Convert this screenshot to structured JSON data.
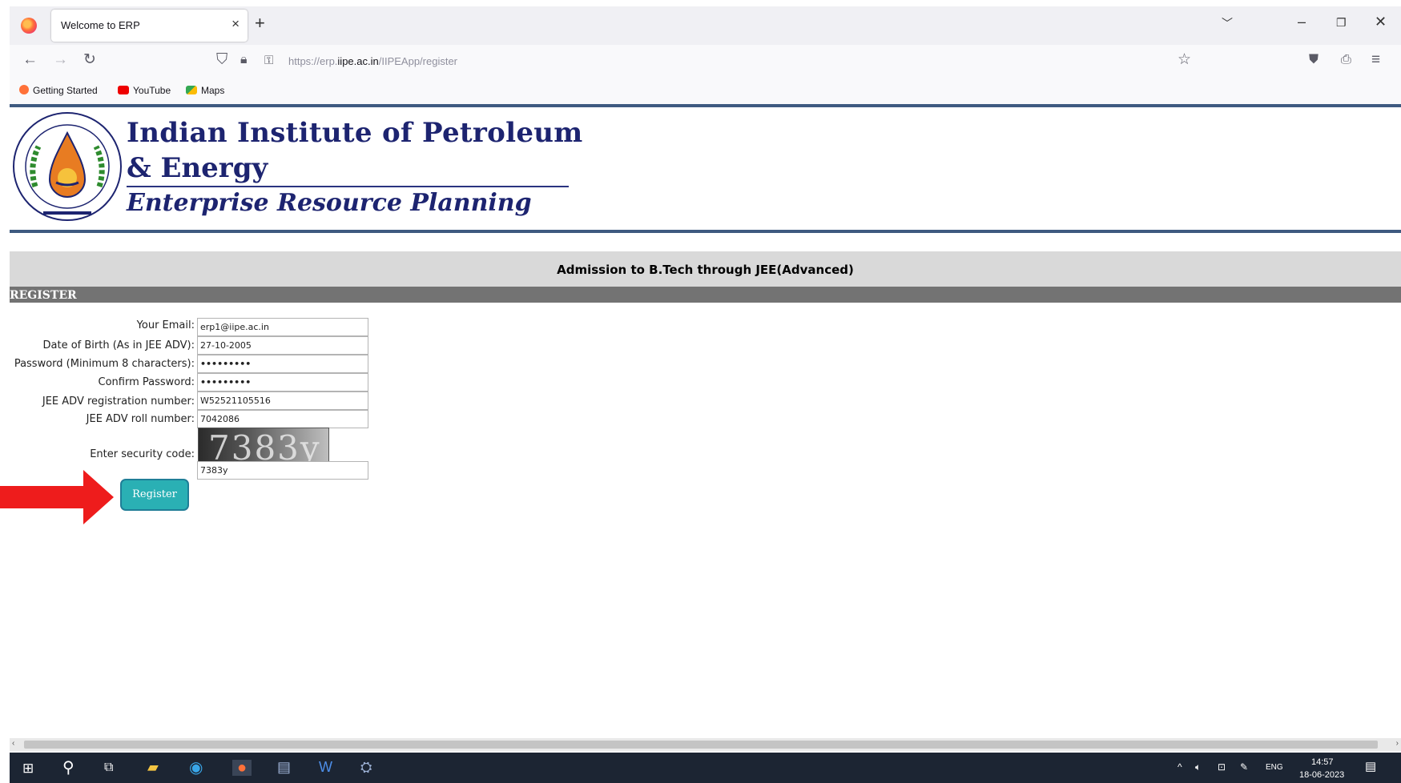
{
  "browser": {
    "tab_title": "Welcome to ERP",
    "tab_close": "×",
    "new_tab": "+",
    "url_prefix": "https://erp.",
    "url_domain": "iipe.ac.in",
    "url_path": "/IIPEApp/register",
    "bookmarks": [
      "Getting Started",
      "YouTube",
      "Maps"
    ]
  },
  "header": {
    "institute_line1": "Indian Institute of Petroleum",
    "institute_line2": "& Energy",
    "erp_title": "Enterprise Resource Planning"
  },
  "page": {
    "admission_title": "Admission to B.Tech through JEE(Advanced)",
    "section_title": "REGISTER"
  },
  "form": {
    "email_label": "Your Email:",
    "email_value": "erp1@iipe.ac.in",
    "dob_label": "Date of Birth (As in JEE ADV):",
    "dob_value": "27-10-2005",
    "password_label": "Password (Minimum 8 characters):",
    "password_value": "•••••••••",
    "confirm_label": "Confirm Password:",
    "confirm_value": "•••••••••",
    "regno_label": "JEE ADV registration number:",
    "regno_value": "W52521105516",
    "roll_label": "JEE ADV roll number:",
    "roll_value": "7042086",
    "security_label": "Enter security code:",
    "captcha_text": "7383y",
    "security_value": "7383y",
    "register_button": "Register"
  },
  "taskbar": {
    "lang": "ENG",
    "time": "14:57",
    "date": "18-06-2023"
  },
  "colors": {
    "header_blue": "#1d2470",
    "rule_blue": "#3e5a80",
    "button_teal": "#2ab0b4",
    "arrow_red": "#ee1c1c"
  }
}
